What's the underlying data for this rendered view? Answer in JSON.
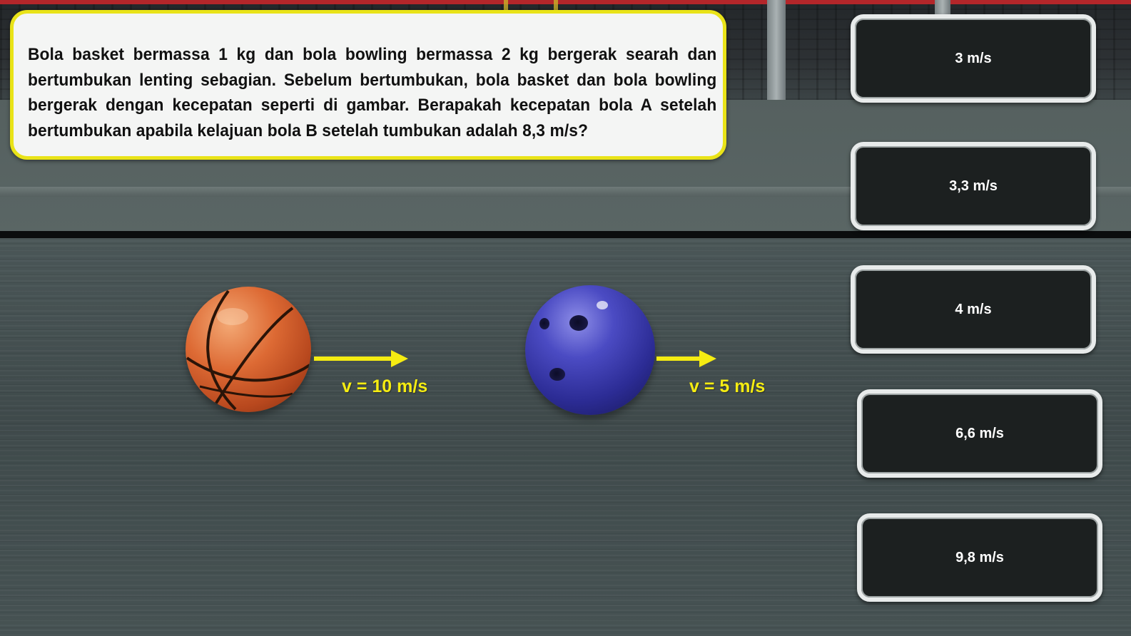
{
  "question": {
    "text": "Bola basket bermassa 1 kg dan bola bowling bermassa 2 kg bergerak searah dan bertumbukan lenting sebagian. Sebelum bertumbukan, bola basket dan bola bowling bergerak dengan kecepatan seperti di gambar. Berapakah kecepatan bola A setelah bertumbukan apabila kelajuan bola B setelah tumbukan adalah 8,3 m/s?"
  },
  "scene": {
    "ball_a": {
      "name": "basketball-icon",
      "velocity_label": "v = 10 m/s"
    },
    "ball_b": {
      "name": "bowling-ball-icon",
      "velocity_label": "v = 5 m/s"
    },
    "accent_color": "#f5ec12"
  },
  "answers": [
    {
      "label": "3 m/s"
    },
    {
      "label": "3,3 m/s"
    },
    {
      "label": "4 m/s"
    },
    {
      "label": "6,6 m/s"
    },
    {
      "label": "9,8 m/s"
    }
  ]
}
